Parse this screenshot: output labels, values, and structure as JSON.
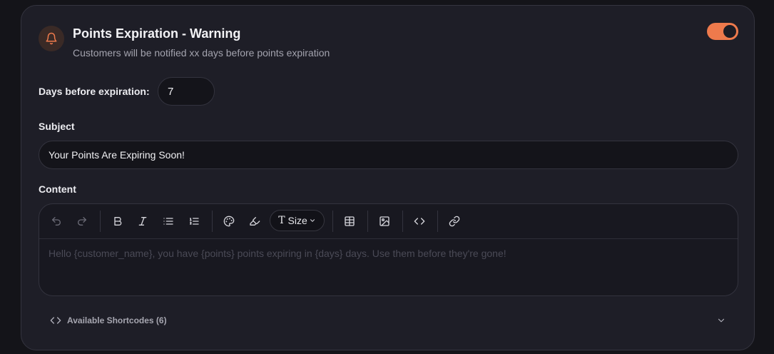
{
  "card": {
    "title": "Points Expiration - Warning",
    "subtitle": "Customers will be notified xx days before points expiration",
    "enabled": true
  },
  "days": {
    "label": "Days before expiration:",
    "value": "7"
  },
  "subject": {
    "label": "Subject",
    "value": "Your Points Are Expiring Soon!"
  },
  "content": {
    "label": "Content",
    "placeholder": "Hello {customer_name}, you have {points} points expiring in {days} days. Use them before they're gone!",
    "toolbar": {
      "size_label": "Size"
    }
  },
  "shortcodes": {
    "label": "Available Shortcodes (6)"
  },
  "colors": {
    "accent": "#ee7a4c",
    "card_bg": "#1e1e27",
    "page_bg": "#141419"
  },
  "icons": [
    "bell-icon",
    "undo-icon",
    "redo-icon",
    "bold-icon",
    "italic-icon",
    "bullet-list-icon",
    "numbered-list-icon",
    "palette-icon",
    "highlighter-icon",
    "text-size-icon",
    "table-icon",
    "image-icon",
    "code-icon",
    "link-icon",
    "chevron-down-icon"
  ]
}
